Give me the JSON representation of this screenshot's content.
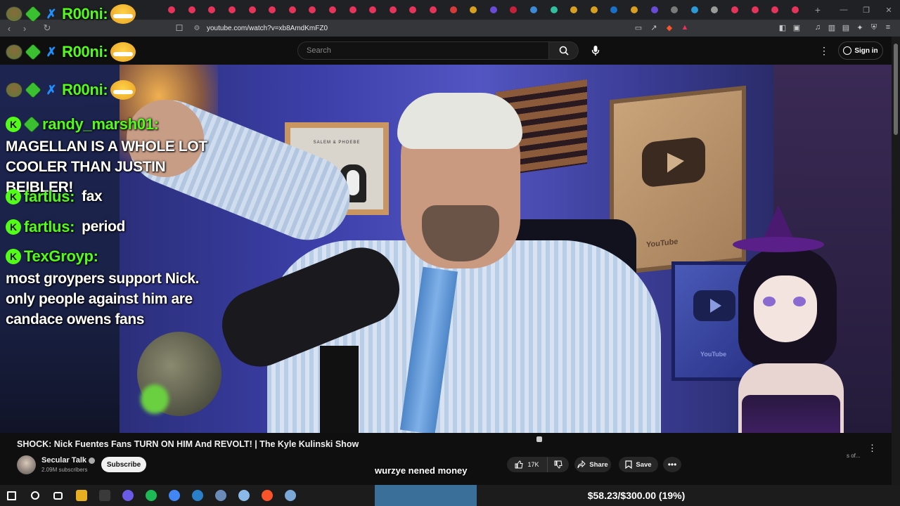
{
  "browser": {
    "url": "youtube.com/watch?v=xb8AmdKmFZ0",
    "tab_colors": [
      "#e8335a",
      "#e8335a",
      "#e8335a",
      "#e8335a",
      "#e8335a",
      "#e8335a",
      "#e8335a",
      "#e8335a",
      "#e8335a",
      "#e8335a",
      "#e8335a",
      "#e8335a",
      "#e8335a",
      "#e8335a",
      "#d83a3a",
      "#d9a020",
      "#6a4ad8",
      "#c8203a",
      "#3a8ad8",
      "#30c0a0",
      "#d9a020",
      "#d9a020",
      "#1a70c8",
      "#d9a020",
      "#6a4ad8",
      "#7a7a7a",
      "#2a9ad8",
      "#9a9a9a",
      "#e8335a",
      "#e8335a",
      "#e8335a",
      "#e8335a"
    ]
  },
  "youtube": {
    "search_placeholder": "Search",
    "sign_in_label": "Sign in"
  },
  "chat": {
    "messages": [
      {
        "user": "R00ni:",
        "text": ""
      },
      {
        "user": "R00ni:",
        "text": ""
      },
      {
        "user": "R00ni:",
        "text": ""
      },
      {
        "user": "randy_marsh01:",
        "text": "MAGELLAN IS A WHOLE LOT COOLER THAN JUSTIN BEIBLER!"
      },
      {
        "user": "fartlus:",
        "text": "fax"
      },
      {
        "user": "fartlus:",
        "text": "period"
      },
      {
        "user": "TexGroyp:",
        "text": "most groypers support Nick. only people against him are candace owens fans"
      }
    ],
    "username_color": "#53fc18"
  },
  "video": {
    "frame_text": "SALEM & PHOEBE",
    "plaque_text": "YouTube",
    "title": "SHOCK: Nick Fuentes Fans TURN ON HIM And REVOLT! | The Kyle Kulinski Show",
    "channel_name": "Secular Talk",
    "subscribers": "2.09M subscribers",
    "subscribe_label": "Subscribe",
    "likes": "17K",
    "share_label": "Share",
    "save_label": "Save",
    "caption": "wurzye nened money",
    "side_snippet": "s of..."
  },
  "taskbar": {
    "goal_text": "$58.23/$300.00 (19%)",
    "goal_fraction": 0.19,
    "icon_colors": [
      "#ffffff",
      "#ffffff",
      "#ffffff",
      "#e8b020",
      "#3a3a3a",
      "#6a5ae8",
      "#1db954",
      "#4285f4",
      "#2a80c8",
      "#6a8ab8",
      "#8ab8e8",
      "#fb542b",
      "#7aa8d8"
    ]
  }
}
